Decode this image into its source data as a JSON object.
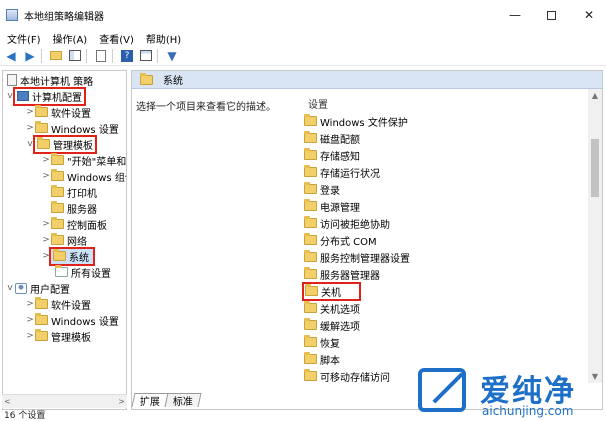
{
  "window": {
    "title": "本地组策略编辑器",
    "min_glyph": "—",
    "close_glyph": "✕"
  },
  "menu": [
    "文件(F)",
    "操作(A)",
    "查看(V)",
    "帮助(H)"
  ],
  "toolbar": {
    "icons": [
      "back-arrow-icon",
      "forward-arrow-icon",
      "up-folder-icon",
      "show-hide-tree-icon",
      "export-list-icon",
      "help-icon",
      "properties-icon",
      "filter-icon"
    ]
  },
  "tree": {
    "root": "本地计算机 策略",
    "computer_config": "计算机配置",
    "software_settings": "软件设置",
    "windows_settings": "Windows 设置",
    "admin_templates": "管理模板",
    "start_menu": "\"开始\"菜单和",
    "windows_components": "Windows 组件",
    "printers": "打印机",
    "servers": "服务器",
    "control_panel": "控制面板",
    "network": "网络",
    "system": "系统",
    "all_settings": "所有设置",
    "user_config": "用户配置",
    "user_software_settings": "软件设置",
    "user_windows_settings": "Windows 设置",
    "user_admin_templates": "管理模板"
  },
  "right_pane": {
    "header": "系统",
    "description": "选择一个项目来查看它的描述。",
    "column_header": "设置",
    "items": [
      "Windows 文件保护",
      "磁盘配额",
      "存储感知",
      "存储运行状况",
      "登录",
      "电源管理",
      "访问被拒绝协助",
      "分布式 COM",
      "服务控制管理器设置",
      "服务器管理器",
      "关机",
      "关机选项",
      "缓解选项",
      "恢复",
      "脚本",
      "可移动存储访问"
    ]
  },
  "tabs": [
    "扩展",
    "标准"
  ],
  "status": "16 个设置",
  "watermark": {
    "cn": "爱纯净",
    "url": "aichunjing.com"
  },
  "colors": {
    "highlight": "#e0231a",
    "header_bg": "#d9e4f4",
    "watermark": "#1d6fc7"
  }
}
